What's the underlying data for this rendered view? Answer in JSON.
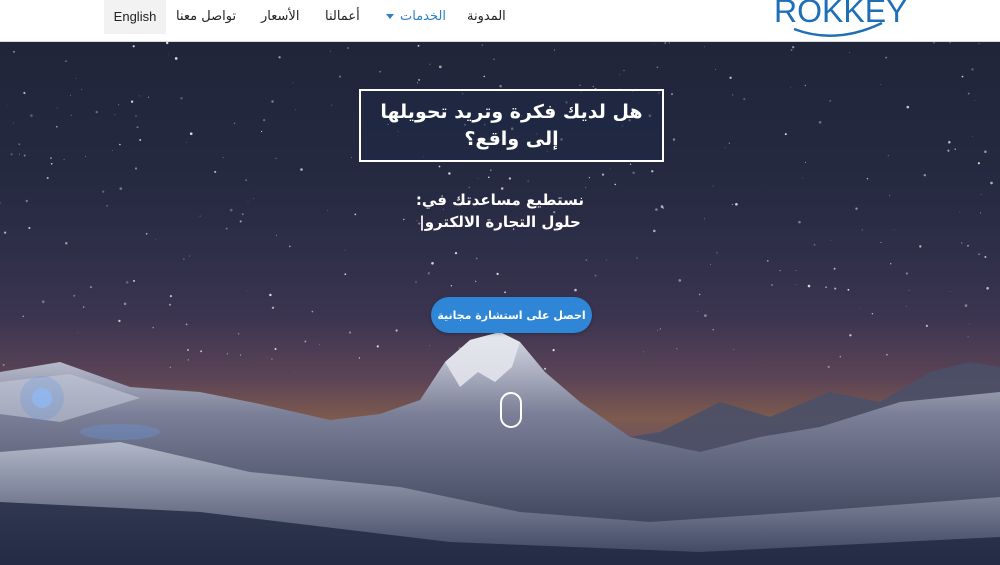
{
  "header": {
    "logo_text": "ROKKEY",
    "nav": [
      {
        "label": "المدونة"
      },
      {
        "label": "الخدمات",
        "active": true
      },
      {
        "label": "أعمالنا"
      },
      {
        "label": "الأسعار"
      },
      {
        "label": "تواصل معنا"
      }
    ],
    "language": "English"
  },
  "hero": {
    "headline_line1": "هل لديك فكرة وتريد تحويلها",
    "headline_line2": "إلى واقع؟",
    "subline_line1": "نستطيع مساعدتك في:",
    "subline_line2": "حلول التجارة الالكترو|",
    "cta_label": "احصل على استشارة مجانية"
  },
  "colors": {
    "accent": "#2f86d6",
    "nav_active": "#2f7fc4",
    "logo": "#1f6fb8"
  }
}
